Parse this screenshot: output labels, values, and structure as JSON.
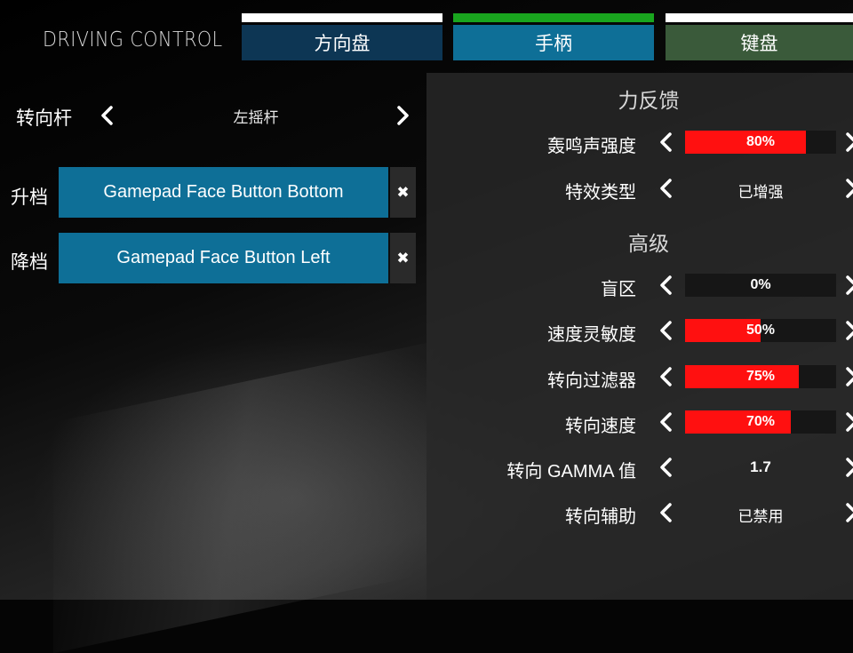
{
  "header": {
    "title": "DRIVING CONTROL"
  },
  "tabs": [
    {
      "label": "方向盘"
    },
    {
      "label": "手柄"
    },
    {
      "label": "键盘"
    }
  ],
  "left": {
    "steering": {
      "label": "转向杆",
      "value": "左摇杆"
    },
    "bindings": [
      {
        "label": "升档",
        "button": "Gamepad Face Button Bottom",
        "clear": "✖"
      },
      {
        "label": "降档",
        "button": "Gamepad Face Button Left",
        "clear": "✖"
      }
    ]
  },
  "right": {
    "force_feedback": {
      "title": "力反馈",
      "rumble": {
        "label": "轰鸣声强度",
        "value": "80%",
        "fraction": 0.8
      },
      "effect_type": {
        "label": "特效类型",
        "value": "已增强"
      }
    },
    "advanced": {
      "title": "高级",
      "deadzone": {
        "label": "盲区",
        "value": "0%",
        "fraction": 0.0
      },
      "speed_sensitivity": {
        "label": "速度灵敏度",
        "value": "50%",
        "fraction": 0.5
      },
      "steering_filter": {
        "label": "转向过滤器",
        "value": "75%",
        "fraction": 0.75
      },
      "steering_speed": {
        "label": "转向速度",
        "value": "70%",
        "fraction": 0.7
      },
      "steering_gamma": {
        "label": "转向 GAMMA 值",
        "value": "1.7"
      },
      "steering_assist": {
        "label": "转向辅助",
        "value": "已禁用"
      }
    }
  },
  "colors": {
    "tab_active_indicator": "#19a51e",
    "tab_gamepad_bg": "#0e6f97",
    "tab_wheel_bg": "#0d3654",
    "tab_keyboard_bg": "#3a5a3a",
    "bar_fill": "#ff1010"
  },
  "icons": {
    "left": "chevron-left-icon",
    "right": "chevron-right-icon",
    "clear": "close-icon"
  }
}
